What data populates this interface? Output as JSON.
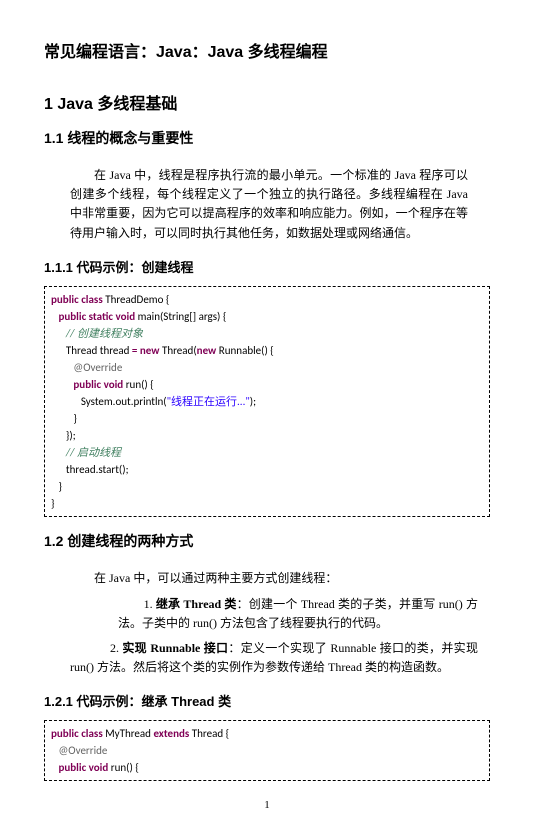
{
  "title": "常见编程语言：Java：Java 多线程编程",
  "h1": "1 Java 多线程基础",
  "s11": {
    "heading": "1.1 线程的概念与重要性",
    "para": "在 Java 中，线程是程序执行流的最小单元。一个标准的 Java 程序可以创建多个线程，每个线程定义了一个独立的执行路径。多线程编程在 Java 中非常重要，因为它可以提高程序的效率和响应能力。例如，一个程序在等待用户输入时，可以同时执行其他任务，如数据处理或网络通信。"
  },
  "s111": {
    "heading": "1.1.1 代码示例：创建线程",
    "code": {
      "l1a": "public class",
      "l1b": " ThreadDemo {",
      "l2a": "public static void",
      "l2b": " main(String[] args) {",
      "l3": "// 创建线程对象",
      "l4a": "Thread thread ",
      "l4b": "=",
      "l4c": " new",
      "l4d": " Thread(",
      "l4e": "new",
      "l4f": " Runnable() {",
      "l5": "@Override",
      "l6a": "public void",
      "l6b": " run() {",
      "l7a": "System.",
      "l7b": "out",
      "l7c": ".println(",
      "l7d": "\"线程正在运行...\"",
      "l7e": ");",
      "l8": "}",
      "l9": "});",
      "l10": "// 启动线程",
      "l11": "thread.start();",
      "l12": "}",
      "l13": "}"
    }
  },
  "s12": {
    "heading": "1.2 创建线程的两种方式",
    "p1": "在 Java 中，可以通过两种主要方式创建线程：",
    "p2a": "1. ",
    "p2b": "继承 Thread 类",
    "p2c": "：创建一个 Thread 类的子类，并重写 run() 方法。子类中的 run() 方法包含了线程要执行的代码。",
    "p3a": "2. ",
    "p3b": "实现 Runnable 接口",
    "p3c": "：定义一个实现了 Runnable 接口的类，并实现 run() 方法。然后将这个类的实例作为参数传递给 Thread 类的构造函数。"
  },
  "s121": {
    "heading": "1.2.1 代码示例：继承 Thread 类",
    "code": {
      "l1a": "public class",
      "l1b": " MyThread ",
      "l1c": "extends",
      "l1d": " Thread {",
      "l2": "@Override",
      "l3a": "public void",
      "l3b": " run() {"
    }
  },
  "pagenum": "1"
}
